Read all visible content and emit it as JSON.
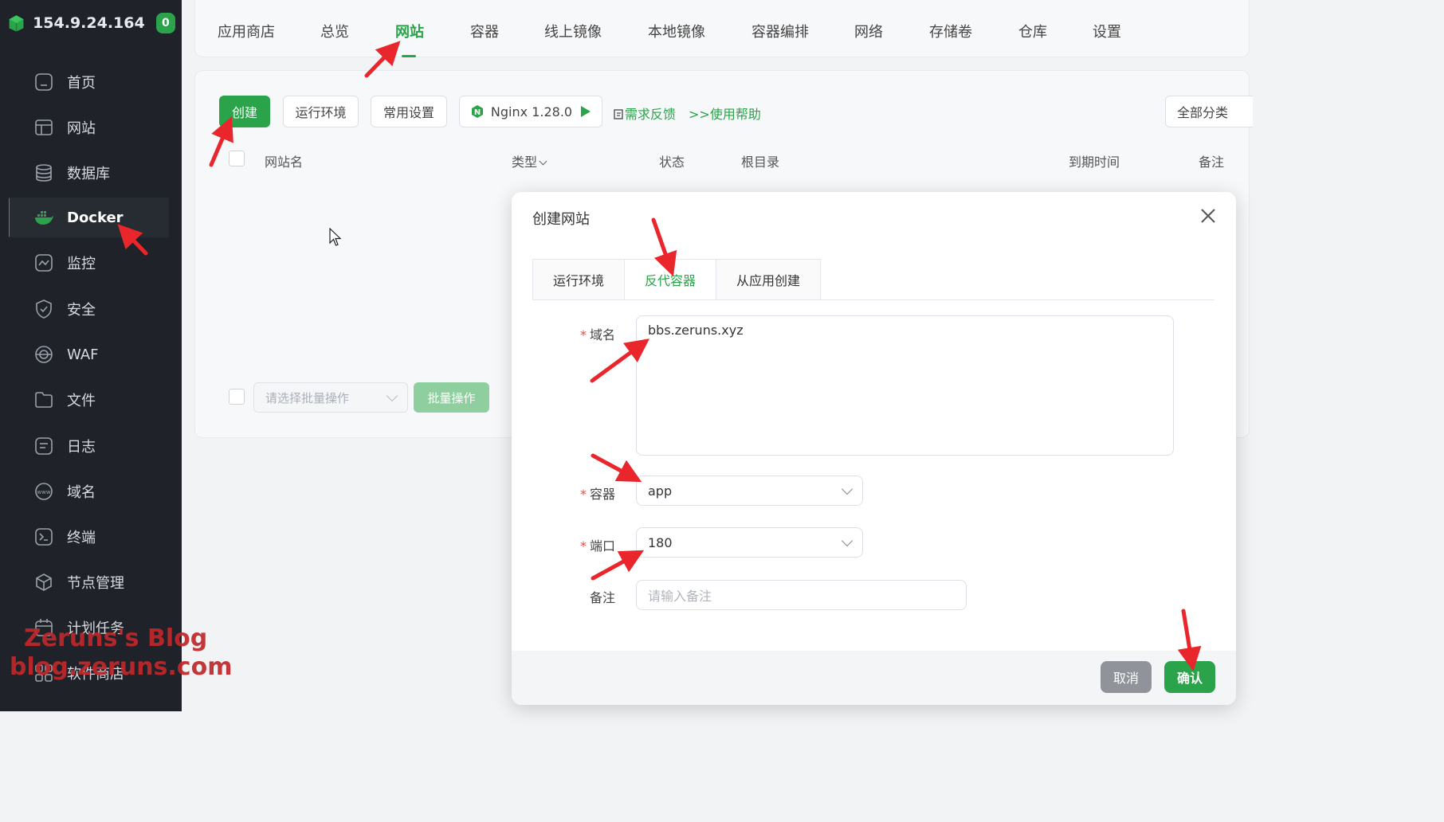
{
  "sidebar": {
    "ip": "154.9.24.164",
    "badge": "0",
    "items": [
      {
        "label": "首页",
        "icon": "home-icon"
      },
      {
        "label": "网站",
        "icon": "website-icon"
      },
      {
        "label": "数据库",
        "icon": "database-icon"
      },
      {
        "label": "Docker",
        "icon": "docker-icon"
      },
      {
        "label": "监控",
        "icon": "monitor-icon"
      },
      {
        "label": "安全",
        "icon": "shield-icon"
      },
      {
        "label": "WAF",
        "icon": "globe-icon"
      },
      {
        "label": "文件",
        "icon": "folder-icon"
      },
      {
        "label": "日志",
        "icon": "log-icon"
      },
      {
        "label": "域名",
        "icon": "www-icon"
      },
      {
        "label": "终端",
        "icon": "terminal-icon"
      },
      {
        "label": "节点管理",
        "icon": "node-icon"
      },
      {
        "label": "计划任务",
        "icon": "calendar-icon"
      },
      {
        "label": "软件商店",
        "icon": "store-icon"
      }
    ]
  },
  "topnav": {
    "tabs": [
      "应用商店",
      "总览",
      "网站",
      "容器",
      "线上镜像",
      "本地镜像",
      "容器编排",
      "网络",
      "存储卷",
      "仓库",
      "设置"
    ],
    "active": "网站"
  },
  "toolbar": {
    "create": "创建",
    "runtime": "运行环境",
    "common_settings": "常用设置",
    "nginx": "Nginx 1.28.0",
    "feedback": "需求反馈",
    "help": ">>使用帮助",
    "category": "全部分类"
  },
  "table": {
    "headers": [
      "网站名",
      "类型",
      "状态",
      "根目录",
      "到期时间",
      "备注"
    ]
  },
  "batch": {
    "placeholder": "请选择批量操作",
    "button": "批量操作"
  },
  "dialog": {
    "title": "创建网站",
    "tabs": [
      "运行环境",
      "反代容器",
      "从应用创建"
    ],
    "active_tab": "反代容器",
    "fields": {
      "domain": {
        "label": "域名",
        "value": "bbs.zeruns.xyz"
      },
      "container": {
        "label": "容器",
        "value": "app"
      },
      "port": {
        "label": "端口",
        "value": "180"
      },
      "remark": {
        "label": "备注",
        "placeholder": "请输入备注"
      }
    },
    "cancel": "取消",
    "confirm": "确认"
  },
  "watermark": {
    "line1": "Zeruns's Blog",
    "line2": "blog.zeruns.com"
  },
  "colors": {
    "accent": "#2aa34a",
    "sidebar_bg": "#1f2329",
    "annotation": "#e8262b"
  }
}
